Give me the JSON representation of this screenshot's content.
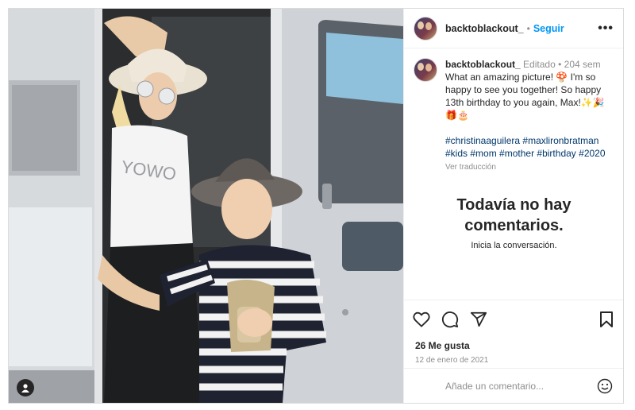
{
  "post": {
    "username": "backtoblackout_",
    "dot": "•",
    "follow_label": "Seguir",
    "more_label": "•••"
  },
  "caption": {
    "username": "backtoblackout_",
    "edited": "Editado",
    "dot": "•",
    "age": "204 sem",
    "text": "What an amazing picture! 🍄 I'm so happy to see you together! So happy 13th birthday to you again, Max!✨🎉🎁🎂",
    "hashtags": [
      "#christinaaguilera",
      "#maxlironbratman",
      "#kids",
      "#mom",
      "#mother",
      "#birthday",
      "#2020"
    ],
    "translate": "Ver traducción"
  },
  "comments": {
    "empty_title_line1": "Todavía no hay",
    "empty_title_line2": "comentarios.",
    "empty_subtitle": "Inicia la conversación."
  },
  "actions": {
    "likes": "26 Me gusta",
    "date": "12 de enero de 2021",
    "comment_placeholder": "Añade un comentario...",
    "icons": [
      "heart-icon",
      "comment-icon",
      "share-icon",
      "bookmark-icon",
      "emoji-icon",
      "user-tag-icon"
    ]
  },
  "colors": {
    "link_blue": "#0095f6",
    "hashtag": "#00376b",
    "muted": "#8e8e8e",
    "text": "#262626"
  }
}
